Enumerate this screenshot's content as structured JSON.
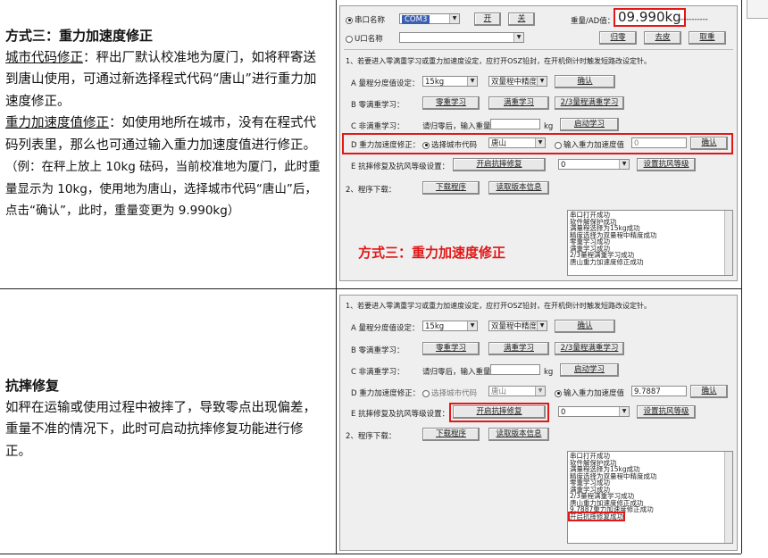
{
  "left": {
    "section1": {
      "title": "方式三：重力加速度修正",
      "p1_term": "城市代码修正",
      "p1_rest": "：秤出厂默认校准地为厦门，如将秤寄送到唐山使用，可通过新选择程式代码“唐山”进行重力加速度修正。",
      "p2_term": "重力加速度值修正",
      "p2_rest": "：如使用地所在城市，没有在程式代码列表里，那么也可通过输入重力加速度值进行修正。",
      "p3": "（例：在秤上放上 10kg 砝码，当前校准地为厦门，此时重量显示为 10kg，使用地为唐山，选择城市代码“唐山”后，点击“确认”，此时，重量变更为 9.990kg）"
    },
    "section2": {
      "title": "抗摔修复",
      "p1": "如秤在运输或使用过程中被摔了，导致零点出现偏差，重量不准的情况下，此时可启动抗摔修复功能进行修正。"
    }
  },
  "shot1": {
    "serial_radio": "串口名称",
    "serial_value": "COM3",
    "open_btn": "开",
    "close_btn": "关",
    "u_radio": "U口名称",
    "weight_label": "重量/AD值：",
    "weight_value": "09.990kg",
    "dashes": "-----------",
    "zero_btn": "归零",
    "tare_btn": "去皮",
    "cancel_btn": "取重",
    "note": "1、若要进入零满重学习或重力加速度设定，应打开OSZ铅封，在开机倒计时触发短路改设定针。",
    "rowA_label": "A 量程分度值设定：",
    "rowA_sel1": "15kg",
    "rowA_sel2": "双量程中精度",
    "rowA_btn": "确认",
    "rowB_label": "B 零满重学习：",
    "rowB_btn1": "零重学习",
    "rowB_btn2": "满重学习",
    "rowB_btn3": "2/3量程满重学习",
    "rowC_label": "C 非满重学习：",
    "rowC_text": "请归零后，输入重量",
    "rowC_unit": "kg",
    "rowC_btn": "启动学习",
    "rowD_label": "D 重力加速度修正：",
    "rowD_radio1": "选择城市代码",
    "rowD_city": "唐山",
    "rowD_radio2": "输入重力加速度值",
    "rowD_value": "0",
    "rowD_btn": "确认",
    "rowE_label": "E 抗摔修复及抗风等级设置：",
    "rowE_btn": "开启抗摔修复",
    "rowE_sel": "0",
    "rowE_btn2": "设置抗风等级",
    "row2_label": "2、程序下载：",
    "row2_btn1": "下载程序",
    "row2_btn2": "读取版本信息",
    "log": [
      "串口打开成功",
      "软件解保护成功",
      "满量程选择为15kg成功",
      "精度选择为双量程中精度成功",
      "零重学习成功",
      "满重学习成功",
      "2/3量程满重学习成功",
      "唐山重力加速度修正成功"
    ],
    "overlay_title": "方式三：重力加速度修正"
  },
  "shot2": {
    "note": "1、若要进入零满重学习或重力加速度设定，应打开OSZ铅封，在开机倒计时触发短路改设定针。",
    "rowA_label": "A 量程分度值设定：",
    "rowA_sel1": "15kg",
    "rowA_sel2": "双量程中精度",
    "rowA_btn": "确认",
    "rowB_label": "B 零满重学习：",
    "rowB_btn1": "零重学习",
    "rowB_btn2": "满重学习",
    "rowB_btn3": "2/3量程满重学习",
    "rowC_label": "C 非满重学习：",
    "rowC_text": "请归零后，输入重量",
    "rowC_unit": "kg",
    "rowC_btn": "启动学习",
    "rowD_label": "D 重力加速度修正：",
    "rowD_radio1": "选择城市代码",
    "rowD_city": "唐山",
    "rowD_radio2": "输入重力加速度值",
    "rowD_value": "9.7887",
    "rowD_btn": "确认",
    "rowE_label": "E 抗摔修复及抗风等级设置：",
    "rowE_btn": "开启抗摔修复",
    "rowE_sel": "0",
    "rowE_btn2": "设置抗风等级",
    "row2_label": "2、程序下载：",
    "row2_btn1": "下载程序",
    "row2_btn2": "读取版本信息",
    "log": [
      "串口打开成功",
      "软件解保护成功",
      "满量程选择为15kg成功",
      "精度选择为双量程中精度成功",
      "零重学习成功",
      "满重学习成功",
      "2/3量程满重学习成功",
      "唐山重力加速度修正成功",
      "9.7887重力加速度修正成功",
      "开启抗摔修复成功"
    ]
  }
}
